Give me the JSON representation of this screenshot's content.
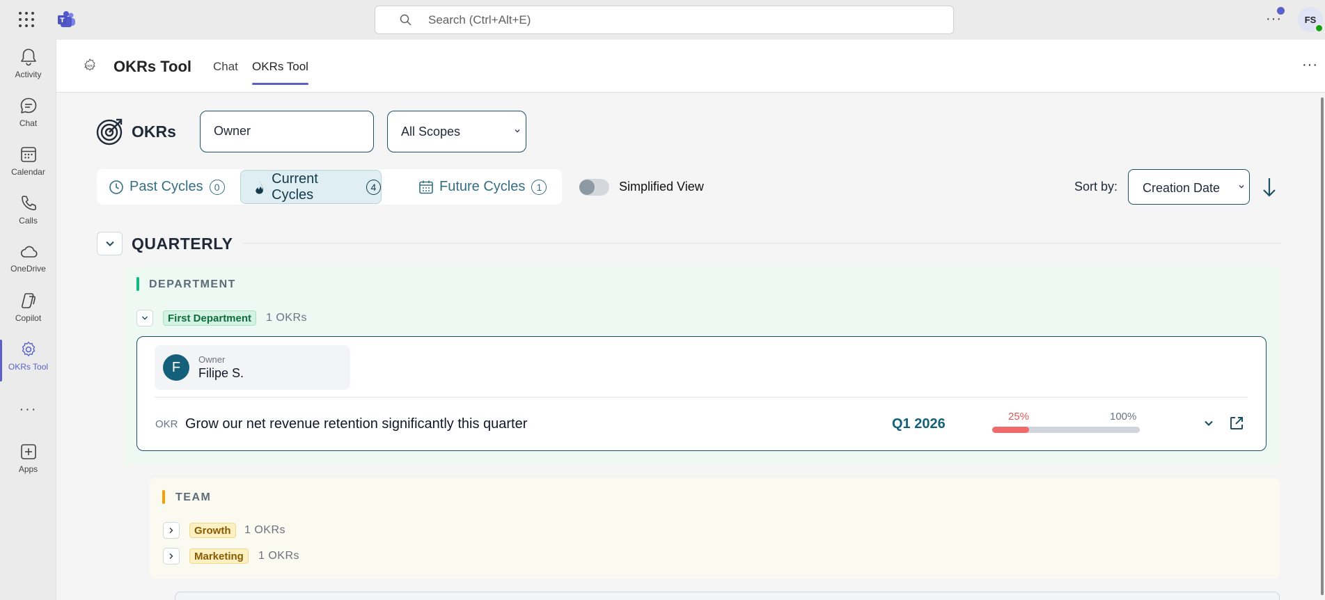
{
  "topbar": {
    "search_placeholder": "Search (Ctrl+Alt+E)",
    "more_icon": "ellipsis-icon",
    "user_initials": "FS",
    "accent_color": "#5b5fc7"
  },
  "rail": {
    "items": [
      {
        "label": "Activity",
        "icon": "bell-icon"
      },
      {
        "label": "Chat",
        "icon": "chat-icon"
      },
      {
        "label": "Calendar",
        "icon": "calendar-icon"
      },
      {
        "label": "Calls",
        "icon": "phone-icon"
      },
      {
        "label": "OneDrive",
        "icon": "cloud-icon"
      },
      {
        "label": "Copilot",
        "icon": "copilot-icon"
      },
      {
        "label": "OKRs Tool",
        "icon": "gear-icon",
        "active": true
      },
      {
        "label": "Apps",
        "icon": "add-app-icon"
      }
    ]
  },
  "app": {
    "title": "OKRs Tool",
    "tabs": [
      {
        "label": "Chat",
        "active": false
      },
      {
        "label": "OKRs Tool",
        "active": true
      }
    ]
  },
  "filters": {
    "heading": "OKRs",
    "owner_placeholder": "Owner",
    "scope_value": "All Scopes"
  },
  "cycles": {
    "tabs": [
      {
        "label": "Past Cycles",
        "count": "0",
        "icon": "clock-icon",
        "active": false
      },
      {
        "label": "Current Cycles",
        "count": "4",
        "icon": "fire-icon",
        "active": true
      },
      {
        "label": "Future Cycles",
        "count": "1",
        "icon": "calendar-icon",
        "active": false
      }
    ],
    "simplified_view_label": "Simplified View",
    "simplified_view_on": false
  },
  "sort": {
    "label": "Sort by:",
    "value": "Creation Date",
    "direction": "descending"
  },
  "group": {
    "title": "QUARTERLY",
    "department": {
      "label": "DEPARTMENT",
      "accent": "#10b981",
      "unit": {
        "name": "First Department",
        "count": "1 OKRs",
        "expanded": true
      },
      "okr": {
        "owner_role": "Owner",
        "owner_name": "Filipe S.",
        "owner_initial": "F",
        "type": "OKR",
        "title": "Grow our net revenue retention significantly this quarter",
        "period": "Q1 2026",
        "progress_label": "25%",
        "progress_max_label": "100%",
        "progress": 0.25
      }
    },
    "team": {
      "label": "TEAM",
      "accent": "#f59e0b",
      "units": [
        {
          "name": "Growth",
          "count": "1 OKRs",
          "expanded": false
        },
        {
          "name": "Marketing",
          "count": "1 OKRs",
          "expanded": false
        }
      ]
    }
  }
}
